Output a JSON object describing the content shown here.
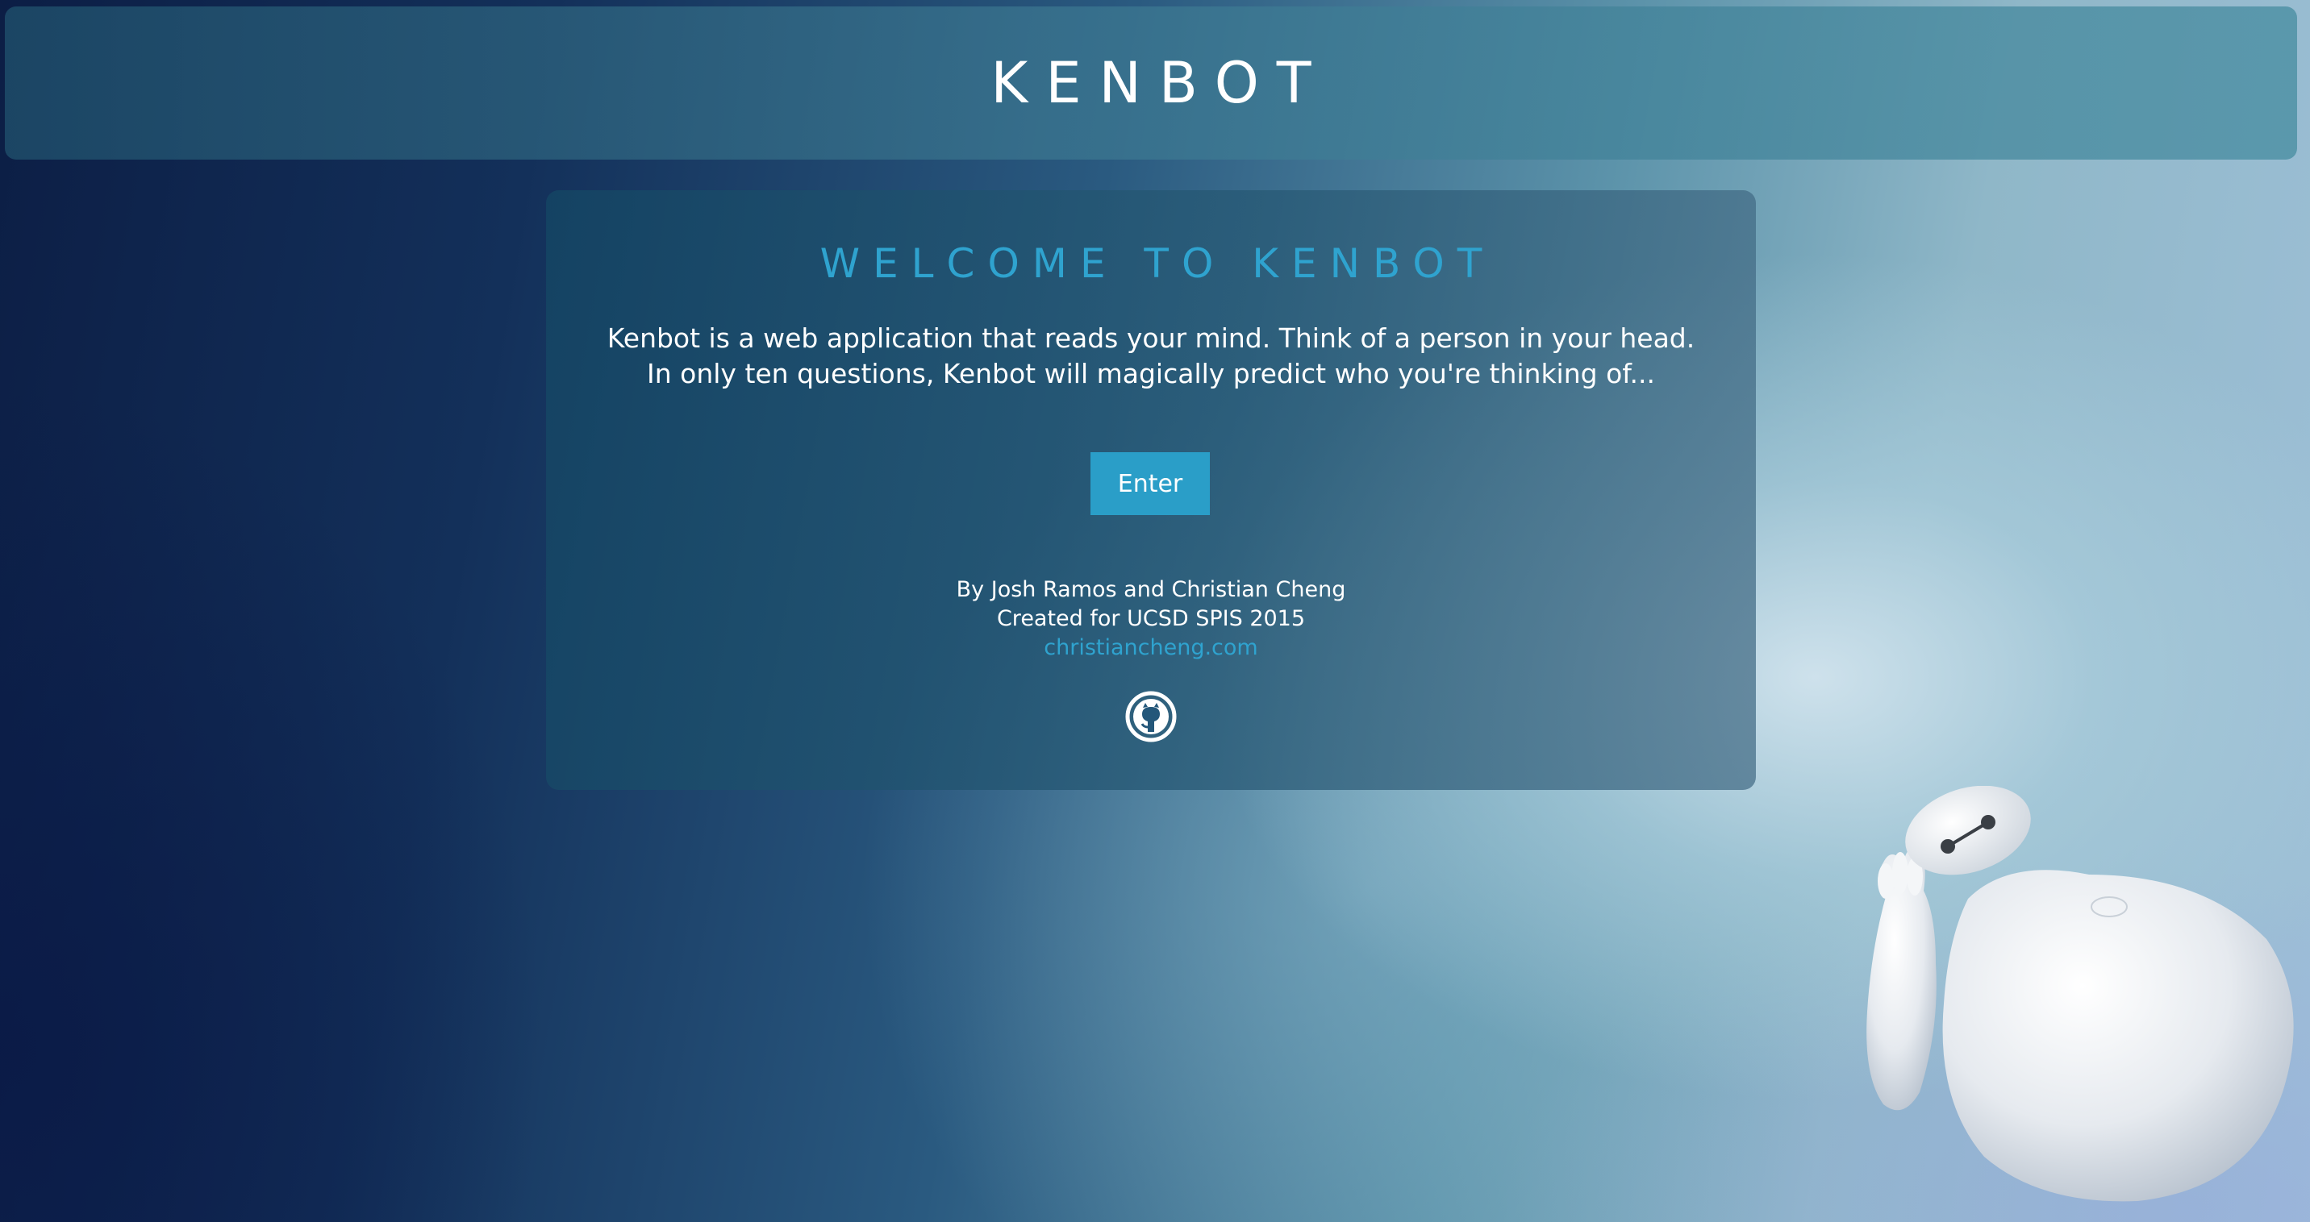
{
  "header": {
    "title": "KENBOT"
  },
  "card": {
    "heading": "WELCOME TO KENBOT",
    "description": "Kenbot is a web application that reads your mind. Think of a person in your head. In only ten questions, Kenbot will magically predict who you're thinking of...",
    "enter_label": "Enter",
    "credits_line1": "By Josh Ramos and Christian Cheng",
    "credits_line2": "Created for UCSD SPIS 2015",
    "credits_link": "christiancheng.com"
  },
  "icons": {
    "github": "github-icon",
    "robot": "baymax-illustration"
  },
  "colors": {
    "accent": "#2fa3cf",
    "button": "#2a9ec8"
  }
}
